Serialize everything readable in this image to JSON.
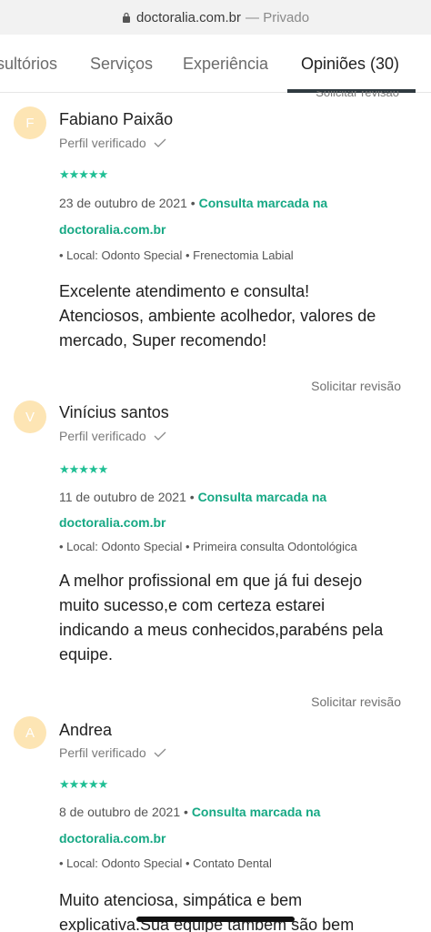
{
  "browser": {
    "url": "doctoralia.com.br",
    "separator": "—",
    "mode": "Privado"
  },
  "tabs": [
    {
      "label": "sultórios"
    },
    {
      "label": "Serviços"
    },
    {
      "label": "Experiência"
    },
    {
      "label": "Opiniões (30)",
      "active": true
    }
  ],
  "top_revision_label": "Solicitar revisão",
  "reviews": [
    {
      "initial": "F",
      "name": "Fabiano Paixão",
      "verified": "Perfil verificado",
      "stars": "★★★★★",
      "date": "23 de outubro de 2021",
      "bullet": "•",
      "booked_prefix": "Consulta marcada na",
      "booked_site": "doctoralia.com.br",
      "local": "• Local: Odonto Special • Frenectomia Labial",
      "text_lines": [
        "Excelente atendimento e consulta!",
        "Atenciosos, ambiente acolhedor, valores de",
        "mercado, Super recomendo!"
      ],
      "solicitar": "Solicitar revisão"
    },
    {
      "initial": "V",
      "name": "Vinícius santos",
      "verified": "Perfil verificado",
      "stars": "★★★★★",
      "date": "11 de outubro de 2021",
      "bullet": "•",
      "booked_prefix": "Consulta marcada na",
      "booked_site": "doctoralia.com.br",
      "local": "• Local: Odonto Special • Primeira consulta Odontológica",
      "text_lines": [
        "A melhor profissional em que já fui desejo",
        "muito sucesso,e com certeza estarei",
        "indicando a meus conhecidos,parabéns pela",
        "equipe."
      ],
      "solicitar": "Solicitar revisão"
    },
    {
      "initial": "A",
      "name": "Andrea",
      "verified": "Perfil verificado",
      "stars": "★★★★★",
      "date": "8 de outubro de 2021",
      "bullet": "•",
      "booked_prefix": "Consulta marcada na",
      "booked_site": "doctoralia.com.br",
      "local": "• Local: Odonto Special • Contato Dental",
      "text_lines": [
        "Muito atenciosa, simpática e bem",
        "explicativa.Sua equipe também são bem"
      ]
    }
  ],
  "colors": {
    "accent_green": "#16a884",
    "star_green": "#1fbf94",
    "avatar_bg": "#fde5b4",
    "tab_underline": "#2f3a40"
  }
}
